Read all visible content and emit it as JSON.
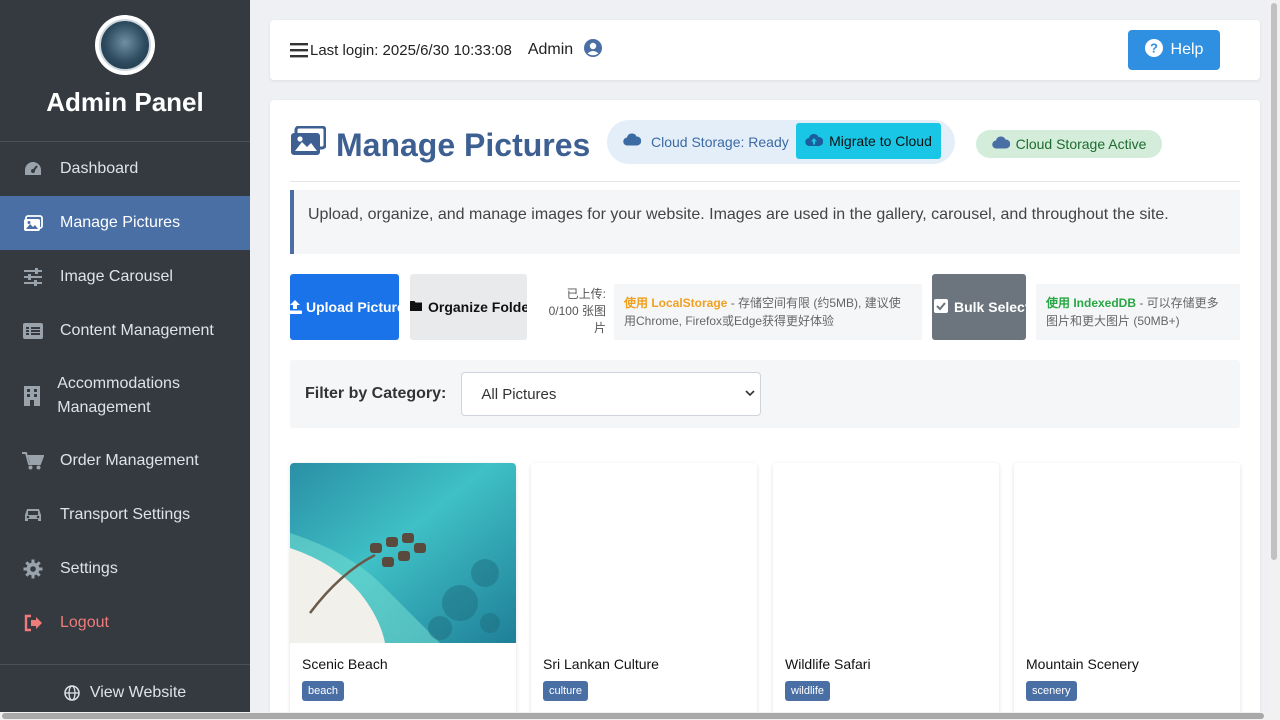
{
  "sidebar": {
    "brand_title": "Admin Panel",
    "logo": "company-logo",
    "items": [
      {
        "label": "Dashboard",
        "icon": "tachometer-icon"
      },
      {
        "label": "Manage Pictures",
        "icon": "images-icon",
        "active": true
      },
      {
        "label": "Image Carousel",
        "icon": "sliders-icon"
      },
      {
        "label": "Content Management",
        "icon": "list-alt-icon"
      },
      {
        "label": "Accommodations Management",
        "icon": "building-icon"
      },
      {
        "label": "Order Management",
        "icon": "cart-icon"
      },
      {
        "label": "Transport Settings",
        "icon": "car-icon"
      },
      {
        "label": "Settings",
        "icon": "gear-icon"
      },
      {
        "label": "Logout",
        "icon": "sign-out-icon"
      }
    ],
    "footer_link": "View Website"
  },
  "topbar": {
    "last_login": "Last login: 2025/6/30 10:33:08",
    "admin_name": "Admin",
    "help_label": "Help"
  },
  "page": {
    "title": "Manage Pictures",
    "cloud_status": "Cloud Storage: Ready",
    "migrate_label": "Migrate to Cloud",
    "cloud_active": "Cloud Storage Active",
    "description": "Upload, organize, and manage images for your website. Images are used in the gallery, carousel, and throughout the site."
  },
  "toolbar": {
    "upload_label": "Upload Picture",
    "organize_label": "Organize Folder",
    "uploaded_count": "已上传: 0/100 张图片",
    "localstorage_highlight": "使用 LocalStorage",
    "localstorage_text": " - 存储空间有限 (约5MB), 建议使用Chrome, Firefox或Edge获得更好体验",
    "bulk_label": "Bulk Select",
    "indexeddb_highlight": "使用 IndexedDB",
    "indexeddb_text": " - 可以存储更多图片和更大图片 (50MB+)"
  },
  "filter": {
    "label": "Filter by Category:",
    "selected": "All Pictures"
  },
  "pictures": [
    {
      "name": "Scenic Beach",
      "tag": "beach"
    },
    {
      "name": "Sri Lankan Culture",
      "tag": "culture"
    },
    {
      "name": "Wildlife Safari",
      "tag": "wildlife"
    },
    {
      "name": "Mountain Scenery",
      "tag": "scenery"
    }
  ],
  "colors": {
    "sidebar_bg": "#343a40",
    "accent": "#4a6fa5",
    "primary": "#1a73e8",
    "info": "#19c6e6",
    "success_bg": "#d4edda"
  }
}
